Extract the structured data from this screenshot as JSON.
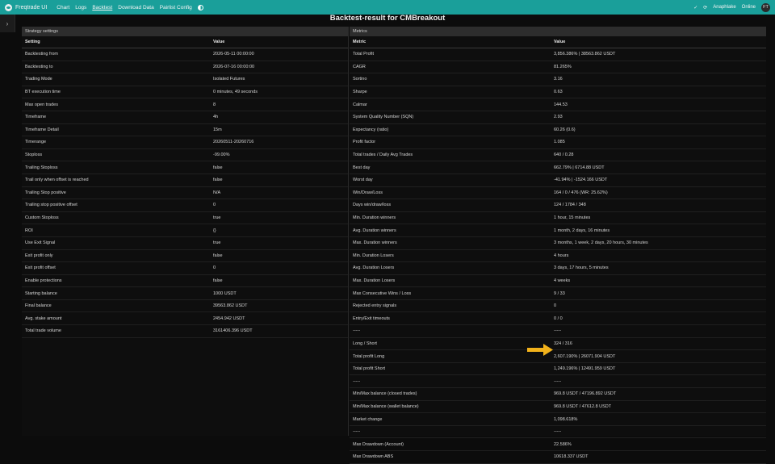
{
  "navbar": {
    "brand": "Freqtrade UI",
    "links": [
      "Chart",
      "Logs",
      "Backtest",
      "Download Data",
      "Pairlist Config"
    ],
    "status": "Anaphlake",
    "online": "Online",
    "avatar_initials": "FT"
  },
  "title": "Backtest-result for CMBreakout",
  "strategy": {
    "header": "Strategy settings",
    "col_setting": "Setting",
    "col_value": "Value",
    "rows": [
      [
        "Backtesting from",
        "2026-05-11 00:00:00"
      ],
      [
        "Backtesting to",
        "2026-07-16 00:00:00"
      ],
      [
        "Trading Mode",
        "Isolated Futures"
      ],
      [
        "BT execution time",
        "0 minutes, 49 seconds"
      ],
      [
        "Max open trades",
        "8"
      ],
      [
        "Timeframe",
        "4h"
      ],
      [
        "Timeframe Detail",
        "15m"
      ],
      [
        "Timerange",
        "20260511-20260716"
      ],
      [
        "Stoploss",
        "-99.00%"
      ],
      [
        "Trailing Stoploss",
        "false"
      ],
      [
        "Trail only when offset is reached",
        "false"
      ],
      [
        "Trailing Stop positive",
        "N/A"
      ],
      [
        "Trailing stop positive offset",
        "0"
      ],
      [
        "Custom Stoploss",
        "true"
      ],
      [
        "ROI",
        "{}"
      ],
      [
        "Use Exit Signal",
        "true"
      ],
      [
        "Exit profit only",
        "false"
      ],
      [
        "Exit profit offset",
        "0"
      ],
      [
        "Enable protections",
        "false"
      ],
      [
        "Starting balance",
        "1000 USDT"
      ],
      [
        "Final balance",
        "39563.862 USDT"
      ],
      [
        "Avg. stake amount",
        "2454.942 USDT"
      ],
      [
        "Total trade volume",
        "3161406.396 USDT"
      ]
    ]
  },
  "metrics": {
    "header": "Metrics",
    "col_metric": "Metric",
    "col_value": "Value",
    "rows": [
      [
        "Total Profit",
        "3,856.386% | 38563.862 USDT"
      ],
      [
        "CAGR",
        "81.265%"
      ],
      [
        "Sortino",
        "3.16"
      ],
      [
        "Sharpe",
        "0.63"
      ],
      [
        "Calmar",
        "144.53"
      ],
      [
        "System Quality Number (SQN)",
        "2.93"
      ],
      [
        "Expectancy (ratio)",
        "60.26 (0.6)"
      ],
      [
        "Profit factor",
        "1.085"
      ],
      [
        "Total trades / Daily Avg Trades",
        "640 / 0.28"
      ],
      [
        "Best day",
        "662.79% | 6714.88 USDT"
      ],
      [
        "Worst day",
        "-41.94% | -1524.166 USDT"
      ],
      [
        "Win/Draw/Loss",
        "164 / 0 / 476 (WR: 25.62%)"
      ],
      [
        "Days win/draw/loss",
        "124 / 1784 / 348"
      ],
      [
        "Min. Duration winners",
        "1 hour, 15 minutes"
      ],
      [
        "Avg. Duration winners",
        "1 month, 2 days, 16 minutes"
      ],
      [
        "Max. Duration winners",
        "3 months, 1 week, 2 days, 20 hours, 30 minutes"
      ],
      [
        "Min. Duration Losers",
        "4 hours"
      ],
      [
        "Avg. Duration Losers",
        "3 days, 17 hours, 5 minutes"
      ],
      [
        "Max. Duration Losers",
        "4 weeks"
      ],
      [
        "Max Consecutive Wins / Loss",
        "9 / 33"
      ],
      [
        "Rejected entry signals",
        "0"
      ],
      [
        "Entry/Exit timeouts",
        "0 / 0"
      ],
      [
        "-----",
        "-----"
      ],
      [
        "Long / Short",
        "324 / 316"
      ],
      [
        "Total profit Long",
        "2,607.190% | 26071.904 USDT"
      ],
      [
        "Total profit Short",
        "1,249.196% | 12491.959 USDT"
      ],
      [
        "-----",
        "-----"
      ],
      [
        "Min/Max balance (closed trades)",
        "969.8 USDT / 47196.892 USDT"
      ],
      [
        "Min/Max balance (wallet balance)",
        "969.8 USDT / 47612.8 USDT"
      ],
      [
        "Market change",
        "1,098.618%"
      ],
      [
        "-----",
        "-----"
      ],
      [
        "Max Drawdown (Account)",
        "22.586%"
      ],
      [
        "Max Drawdown ABS",
        "10618.337 USDT"
      ]
    ]
  },
  "colors": {
    "navbar": "#1a9f9a",
    "arrow": "#f2b21b"
  }
}
